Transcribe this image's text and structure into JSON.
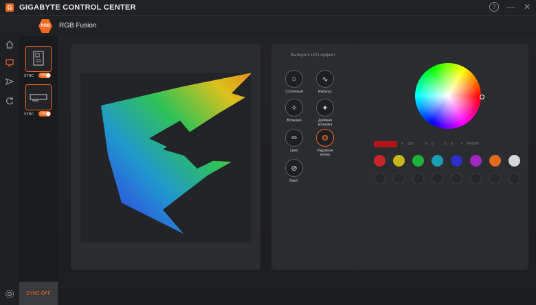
{
  "app": {
    "title": "GIGABYTE CONTROL CENTER",
    "logo_letter": "G"
  },
  "window": {
    "help": "?",
    "minimize": "—",
    "close": "✕"
  },
  "header": {
    "badge": "RGB",
    "title": "RGB Fusion"
  },
  "rail": {
    "items": [
      "home-icon",
      "monitor-icon",
      "send-icon",
      "refresh-icon"
    ],
    "settings": "gear-icon"
  },
  "devices": [
    {
      "name": "motherboard-icon",
      "sync_label": "SYNC",
      "toggle": "ON"
    },
    {
      "name": "graphics-card-icon",
      "sync_label": "SYNC",
      "toggle": "ON"
    }
  ],
  "sync_off_label": "SYNC OFF",
  "effects": {
    "title": "Выберите LED эффект",
    "items": [
      {
        "label": "Статичный",
        "icon": "sun-icon",
        "glyph": "☼"
      },
      {
        "label": "Импульс",
        "icon": "pulse-icon",
        "glyph": "∿"
      },
      {
        "label": "Вспышка",
        "icon": "flash-icon",
        "glyph": "✧"
      },
      {
        "label": "Двойная вспышка",
        "icon": "double-flash-icon",
        "glyph": "✦"
      },
      {
        "label": "Цикл",
        "icon": "cycle-icon",
        "glyph": "∞"
      },
      {
        "label": "Радужная волна",
        "icon": "rainbow-wave-icon",
        "glyph": "❂"
      },
      {
        "label": "Выкл.",
        "icon": "off-icon",
        "glyph": "⊘"
      }
    ]
  },
  "color": {
    "current": "#b3141a",
    "r_label": "R",
    "r_value": "255",
    "g_label": "G",
    "g_value": "0",
    "b_label": "B",
    "b_value": "0",
    "hex_label": "#",
    "hex_value": "FF0000",
    "presets": [
      "#c8262b",
      "#c9b51c",
      "#1fb23a",
      "#1c9db5",
      "#2a31c4",
      "#a227c0",
      "#e26a1f",
      "#d6d6d6"
    ]
  }
}
